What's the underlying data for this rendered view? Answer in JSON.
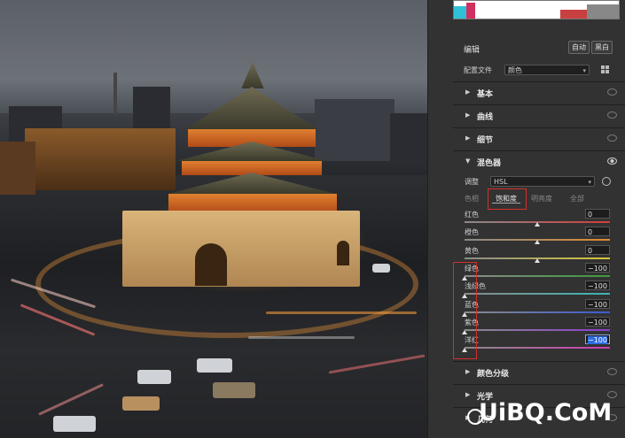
{
  "edit": {
    "title": "编辑",
    "auto_label": "自动",
    "bw_label": "黑白",
    "profile_label": "配置文件",
    "profile_value": "颜色"
  },
  "sections_top": [
    {
      "name": "基本"
    },
    {
      "name": "曲线"
    },
    {
      "name": "细节"
    }
  ],
  "mixer": {
    "name": "混色器",
    "adjust_label": "调整",
    "adjust_value": "HSL",
    "tabs": [
      "色相",
      "饱和度",
      "明亮度",
      "全部"
    ],
    "active_tab": "饱和度",
    "sliders": [
      {
        "label": "红色",
        "value": "0",
        "pos": 0.5,
        "color_from": "#d23c3c",
        "color_to": "#d23c3c"
      },
      {
        "label": "橙色",
        "value": "0",
        "pos": 0.5,
        "color_from": "#e08a2e",
        "color_to": "#e08a2e"
      },
      {
        "label": "黄色",
        "value": "0",
        "pos": 0.5,
        "color_from": "#d8c838",
        "color_to": "#d8c838"
      },
      {
        "label": "绿色",
        "value": "−100",
        "pos": 0,
        "color_from": "#3c9a3c",
        "color_to": "#3c9a3c"
      },
      {
        "label": "浅绿色",
        "value": "−100",
        "pos": 0,
        "color_from": "#3cb4b4",
        "color_to": "#3cb4b4"
      },
      {
        "label": "蓝色",
        "value": "−100",
        "pos": 0,
        "color_from": "#3c5ad2",
        "color_to": "#3c5ad2"
      },
      {
        "label": "紫色",
        "value": "−100",
        "pos": 0,
        "color_from": "#8c3cd2",
        "color_to": "#8c3cd2"
      },
      {
        "label": "洋红",
        "value": "−100",
        "pos": 0,
        "color_from": "#d23cb4",
        "color_to": "#d23cb4",
        "selected": true
      }
    ]
  },
  "sections_bottom": [
    {
      "name": "颜色分级"
    },
    {
      "name": "光学"
    },
    {
      "name": "几何"
    }
  ],
  "watermark": "UiBQ.CoM",
  "colors": {
    "panel_bg": "#323232",
    "highlight_box": "#d4302a",
    "selected_value_bg": "#2e6de0"
  }
}
